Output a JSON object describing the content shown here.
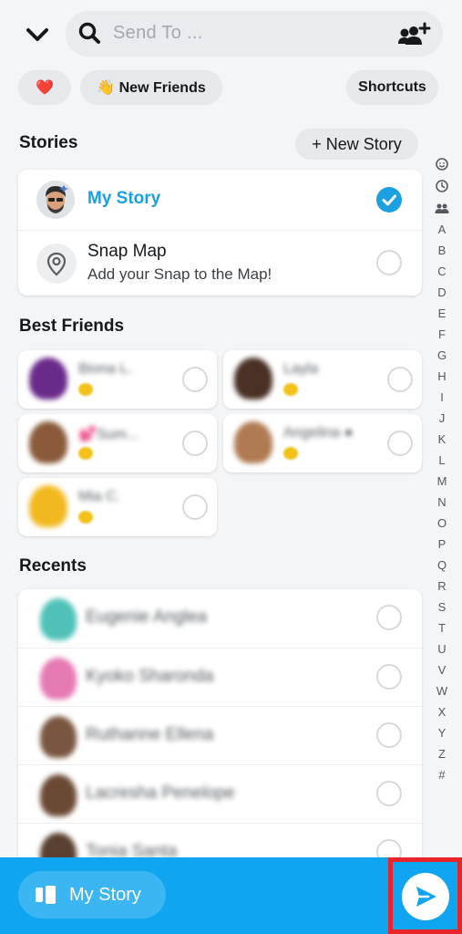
{
  "search": {
    "placeholder": "Send To ..."
  },
  "chips": {
    "heart": "❤️",
    "new_friends": "👋 New Friends",
    "shortcuts": "Shortcuts"
  },
  "stories": {
    "title": "Stories",
    "new_story_label": "+ New Story",
    "my_story": "My Story",
    "snap_map": {
      "title": "Snap Map",
      "subtitle": "Add your Snap to the Map!"
    }
  },
  "best_friends": {
    "title": "Best Friends",
    "items": [
      {
        "name": "Biona L.",
        "avatar_color": "#6a2a8a"
      },
      {
        "name": "Layla",
        "avatar_color": "#4a3025"
      },
      {
        "name": "💕Sum...",
        "avatar_color": "#8a5a3a"
      },
      {
        "name": "Angelina ●",
        "avatar_color": "#b07a52"
      },
      {
        "name": "Mia C.",
        "avatar_color": "#f2b81f"
      }
    ]
  },
  "recents": {
    "title": "Recents",
    "items": [
      {
        "name": "Eugenie Anglea",
        "avatar_color": "#4fc1b8"
      },
      {
        "name": "Kyoko Sharonda",
        "avatar_color": "#e57ab3"
      },
      {
        "name": "Ruthanne Ellena",
        "avatar_color": "#7a5640"
      },
      {
        "name": "Lacresha Penelope",
        "avatar_color": "#6b4a35"
      },
      {
        "name": "Tonia Santa",
        "avatar_color": "#5a4030"
      }
    ]
  },
  "index": [
    "A",
    "B",
    "C",
    "D",
    "E",
    "F",
    "G",
    "H",
    "I",
    "J",
    "K",
    "L",
    "M",
    "N",
    "O",
    "P",
    "Q",
    "R",
    "S",
    "T",
    "U",
    "V",
    "W",
    "X",
    "Y",
    "Z",
    "#"
  ],
  "bottom": {
    "my_story_label": "My Story"
  },
  "colors": {
    "accent": "#0fa5f0",
    "highlight": "#e8262a"
  }
}
